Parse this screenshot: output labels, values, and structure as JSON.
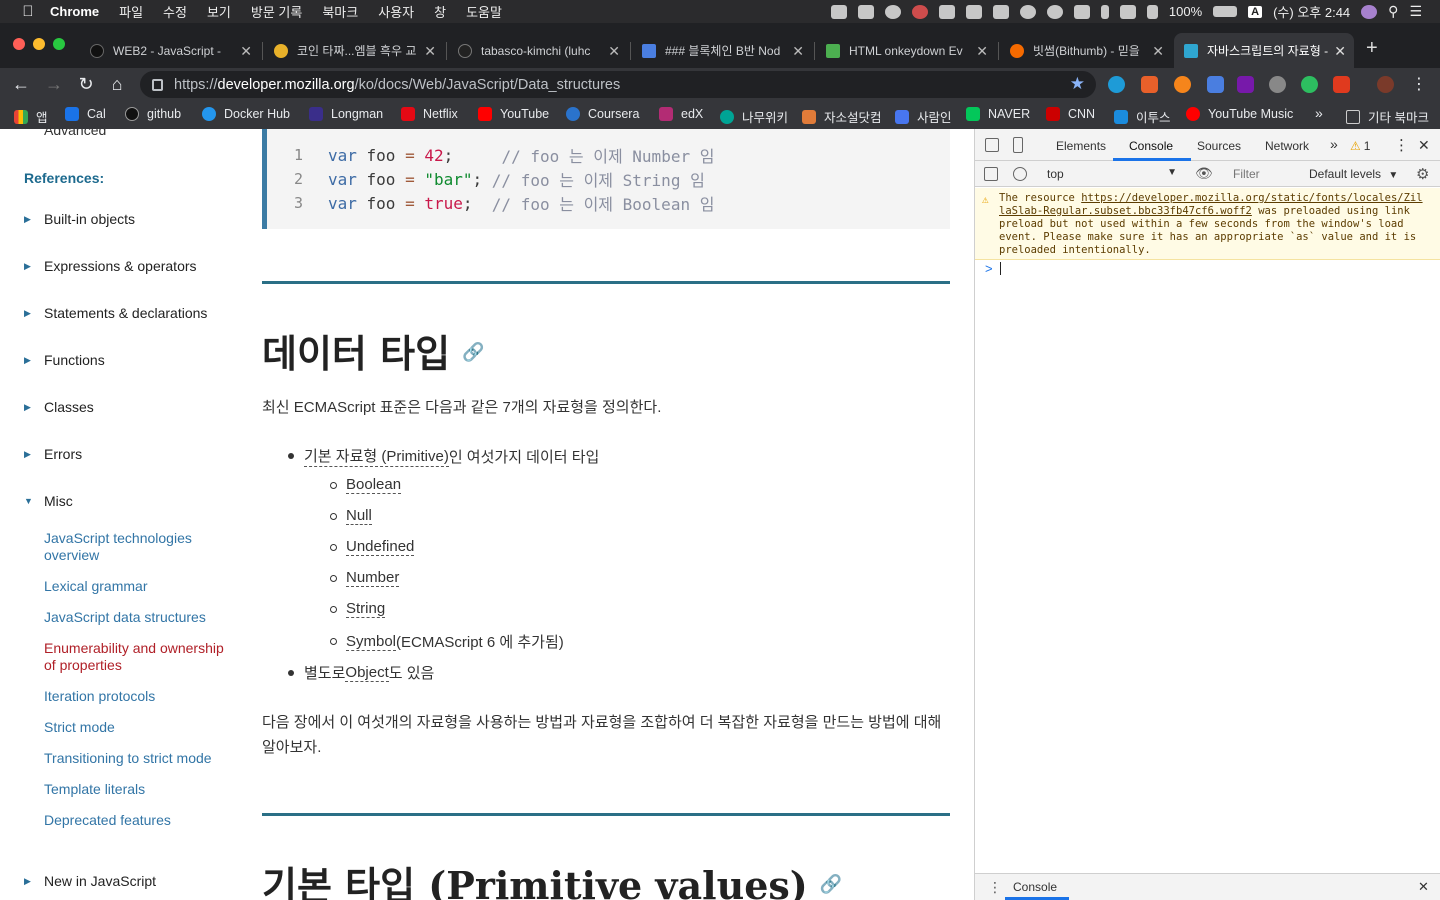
{
  "menubar": {
    "app_name": "Chrome",
    "items": [
      "파일",
      "수정",
      "보기",
      "방문 기록",
      "북마크",
      "사용자",
      "창",
      "도움말"
    ],
    "battery": "100%",
    "input_source": "A",
    "clock": "(수) 오후 2:44"
  },
  "tabs": [
    {
      "title": "WEB2 - JavaScript -",
      "favicon_color": "#111111"
    },
    {
      "title": "코인 타짜...엠블 흑우 교",
      "favicon_color": "#e8b12a"
    },
    {
      "title": "tabasco-kimchi (luhc",
      "favicon_color": "#222222"
    },
    {
      "title": "### 블록체인 B반 Nod",
      "favicon_color": "#4a7ee0"
    },
    {
      "title": "HTML onkeydown Ev",
      "favicon_color": "#4caf50"
    },
    {
      "title": "빗썸(Bithumb) - 믿을 ",
      "favicon_color": "#f56a00"
    },
    {
      "title": "자바스크립트의 자료형 -",
      "favicon_color": "#2fa6d0",
      "active": true
    }
  ],
  "omnibox": {
    "scheme": "https://",
    "host": "developer.mozilla.org",
    "path": "/ko/docs/Web/JavaScript/Data_structures"
  },
  "bookmarks": [
    {
      "label": "앱",
      "color": "#e94335"
    },
    {
      "label": "Cal",
      "color": "#1a73e8"
    },
    {
      "label": "github",
      "color": "#111111"
    },
    {
      "label": "Docker Hub",
      "color": "#2496ed"
    },
    {
      "label": "Longman",
      "color": "#3a2e8a"
    },
    {
      "label": "Netflix",
      "color": "#e50914"
    },
    {
      "label": "YouTube",
      "color": "#ff0000"
    },
    {
      "label": "Coursera",
      "color": "#2a73cc"
    },
    {
      "label": "edX",
      "color": "#b32c74"
    },
    {
      "label": "나무위키",
      "color": "#00a495"
    },
    {
      "label": "자소설닷컴",
      "color": "#e07b39"
    },
    {
      "label": "사람인",
      "color": "#4876ef"
    },
    {
      "label": "NAVER",
      "color": "#03c75a"
    },
    {
      "label": "CNN",
      "color": "#cc0000"
    },
    {
      "label": "이투스",
      "color": "#1b8cde"
    },
    {
      "label": "YouTube Music",
      "color": "#ff0000"
    }
  ],
  "bookmarks_more": "»",
  "bookmarks_other": "기타 북마크",
  "sidebar": {
    "cut_item": "Advanced",
    "references_heading": "References:",
    "items": [
      "Built-in objects",
      "Expressions & operators",
      "Statements & declarations",
      "Functions",
      "Classes",
      "Errors",
      "Misc"
    ],
    "misc_links": [
      "JavaScript technologies overview",
      "Lexical grammar",
      "JavaScript data structures",
      "Enumerability and ownership of properties",
      "Iteration protocols",
      "Strict mode",
      "Transitioning to strict mode",
      "Template literals",
      "Deprecated features"
    ],
    "current_link": "Enumerability and ownership of properties",
    "bottom_item": "New in JavaScript"
  },
  "code": {
    "lines": [
      {
        "n": "1",
        "kw": "var",
        "name": " foo ",
        "op": "=",
        "val": " 42",
        "type": "num",
        "semi": ";",
        "pad": "     ",
        "comment": "// foo 는 이제 Number 임"
      },
      {
        "n": "2",
        "kw": "var",
        "name": " foo ",
        "op": "=",
        "val": " \"bar\"",
        "type": "str",
        "semi": ";",
        "pad": " ",
        "comment": "// foo 는 이제 String 임"
      },
      {
        "n": "3",
        "kw": "var",
        "name": " foo ",
        "op": "=",
        "val": " true",
        "type": "bool",
        "semi": ";",
        "pad": "  ",
        "comment": "// foo 는 이제 Boolean 임"
      }
    ]
  },
  "article": {
    "h2_datatypes": "데이터 타입",
    "intro": "최신 ECMAScript 표준은 다음과 같은 7개의 자료형을  정의한다.",
    "primitive_link": "기본 자료형 (Primitive)",
    "primitive_tail": " 인 여섯가지 데이터 타입",
    "primitives": [
      "Boolean",
      "Null",
      "Undefined",
      "Number",
      "String",
      "Symbol"
    ],
    "symbol_tail": " (ECMAScript 6 에 추가됨)",
    "object_prefix": "별도로 ",
    "object_link": "Object",
    "object_tail": " 도 있음",
    "paragraph": "다음 장에서 이 여섯개의 자료형을 사용하는 방법과 자료형을 조합하여 더 복잡한 자료형을 만드는 방법에 대해 알아보자.",
    "h2_primitive": "기본 타입 (Primitive values)"
  },
  "devtools": {
    "tabs": [
      "Elements",
      "Console",
      "Sources",
      "Network"
    ],
    "active_tab": "Console",
    "more": "»",
    "warning_count": "1",
    "context": "top",
    "filter_placeholder": "Filter",
    "levels": "Default levels",
    "warning_pre": "The resource ",
    "warning_url": "https://developer.mozilla.org/static/fonts/locales/ZillaSlab-Regular.subset.bbc33fb47cf6.woff2",
    "warning_post": " was preloaded using link preload but not used within a few seconds from the window's load event. Please make sure it has an appropriate `as` value and it is preloaded intentionally.",
    "prompt": ">",
    "drawer_tab": "Console"
  },
  "colors": {
    "mdn_link": "#3275a6",
    "mdn_current": "#b02028",
    "devtools_accent": "#1a73e8"
  }
}
